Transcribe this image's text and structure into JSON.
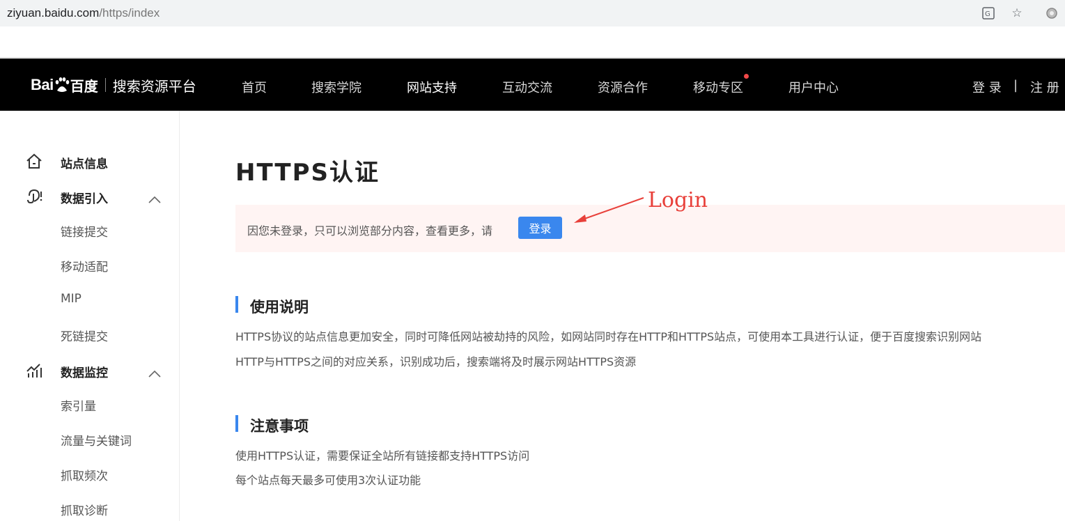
{
  "browser": {
    "url_host": "ziyuan.baidu.com",
    "url_path": "/https/index",
    "icons": [
      "translate-icon",
      "star-icon",
      "extension-icon"
    ]
  },
  "header": {
    "logo_bai": "Bai",
    "logo_cn": "百度",
    "platform": "搜索资源平台",
    "nav": [
      "首页",
      "搜索学院",
      "网站支持",
      "互动交流",
      "资源合作",
      "移动专区",
      "用户中心"
    ],
    "active_nav": "网站支持",
    "login": "登 录",
    "divider": "|",
    "register": "注 册"
  },
  "sidebar": {
    "groups": [
      {
        "label": "站点信息",
        "icon": "home-icon"
      },
      {
        "label": "数据引入",
        "icon": "data-import-icon",
        "items": [
          "链接提交",
          "移动适配",
          "MIP",
          "死链提交"
        ]
      },
      {
        "label": "数据监控",
        "icon": "chart-icon",
        "items": [
          "索引量",
          "流量与关键词",
          "抓取频次",
          "抓取诊断"
        ]
      }
    ]
  },
  "main": {
    "title": "HTTPS认证",
    "notice_text": "因您未登录，只可以浏览部分内容，查看更多，请",
    "notice_button": "登录",
    "annotation": "Login",
    "usage_title": "使用说明",
    "usage_lines": [
      "HTTPS协议的站点信息更加安全，同时可降低网站被劫持的风险，如网站同时存在HTTP和HTTPS站点，可使用本工具进行认证，便于百度搜索识别网站",
      "HTTP与HTTPS之间的对应关系，识别成功后，搜索端将及时展示网站HTTPS资源"
    ],
    "notes_title": "注意事项",
    "notes_lines": [
      "使用HTTPS认证，需要保证全站所有链接都支持HTTPS访问",
      "每个站点每天最多可使用3次认证功能"
    ]
  },
  "colors": {
    "accent": "#3a87ee",
    "annotation": "#e8403a",
    "notice_bg": "#fff4f3",
    "nav_bg": "#000000"
  }
}
